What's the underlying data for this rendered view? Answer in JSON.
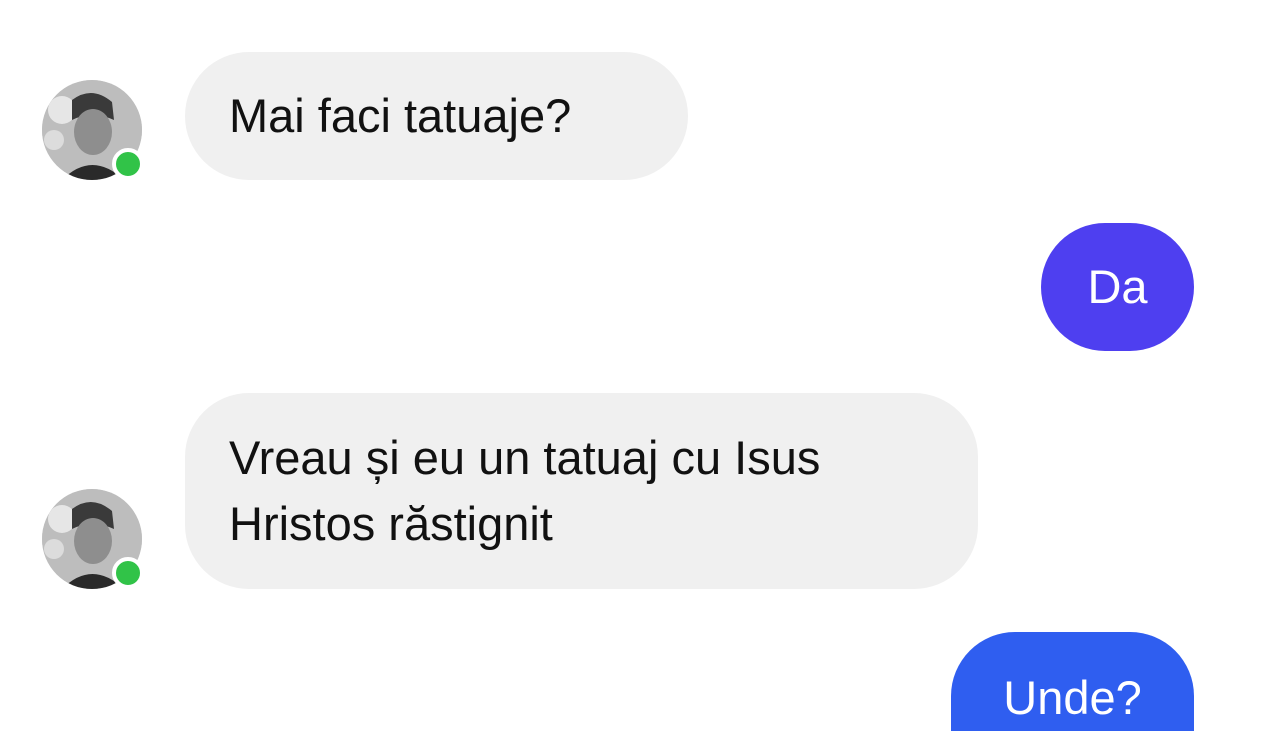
{
  "conversation": {
    "messages": [
      {
        "sender": "contact",
        "text": "Mai faci tatuaje?"
      },
      {
        "sender": "me",
        "text": "Da"
      },
      {
        "sender": "contact",
        "line1": "Vreau și eu un tatuaj cu Isus",
        "line2": "Hristos răstignit"
      },
      {
        "sender": "me",
        "text": "Unde?"
      }
    ]
  },
  "contact": {
    "avatar_icon": "user-avatar-photo",
    "online": true,
    "online_color": "#31c348"
  },
  "colors": {
    "incoming_bubble": "#f0f0f0",
    "outgoing_bubble_1": "#4e3ff0",
    "outgoing_bubble_2": "#2f5ef0"
  }
}
